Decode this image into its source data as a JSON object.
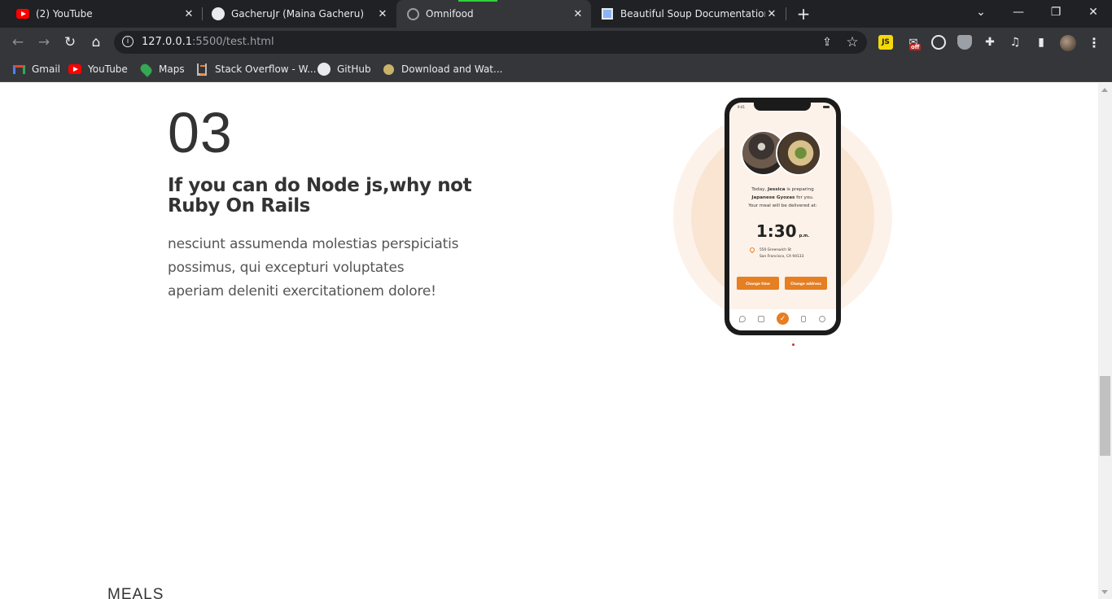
{
  "browser": {
    "tabs": [
      {
        "title": "(2) YouTube",
        "icon": "youtube-icon"
      },
      {
        "title": "GacheruJr (Maina Gacheru)",
        "icon": "github-icon"
      },
      {
        "title": "Omnifood",
        "icon": "globe-icon",
        "active": true
      },
      {
        "title": "Beautiful Soup Documentation —",
        "icon": "doc-icon"
      }
    ],
    "close_glyph": "✕",
    "new_tab_glyph": "+",
    "window": {
      "chevron": "⌄",
      "minimize": "—",
      "restore": "❐",
      "close": "✕"
    },
    "url_host": "127.0.0.1",
    "url_path": ":5500/test.html",
    "toolbar_glyphs": {
      "back": "←",
      "forward": "→",
      "reload": "↻",
      "home": "⌂",
      "info": "i",
      "share": "⇪",
      "star": "☆",
      "menu": "⋮",
      "puzzle": "✚",
      "sidepanel": "▮",
      "media": "♫",
      "mail": "✉",
      "ext_js": "JS",
      "ext_off": "off"
    },
    "bookmarks": [
      {
        "label": "Gmail",
        "icon": "gmail-icon"
      },
      {
        "label": "YouTube",
        "icon": "youtube-icon"
      },
      {
        "label": "Maps",
        "icon": "maps-icon"
      },
      {
        "label": "Stack Overflow - W...",
        "icon": "stackoverflow-icon"
      },
      {
        "label": "GitHub",
        "icon": "github-icon"
      },
      {
        "label": "Download and Wat...",
        "icon": "download-icon"
      }
    ]
  },
  "step": {
    "number": "03",
    "title": "If you can do Node js,why not Ruby On Rails",
    "description": "nesciunt assumenda molestias perspiciatis possimus, qui excepturi voluptates aperiam deleniti exercitationem dolore!"
  },
  "phone": {
    "status_time": "9:41",
    "meal_line1_pre": "Today, ",
    "meal_name": "Jessica",
    "meal_line1_post": " is preparing",
    "meal_dish": "Japanese Gyozas",
    "meal_line2_post": " for you.",
    "meal_line3": "Your meal will be delivered at:",
    "eta_time": "1:30",
    "eta_suffix": "p.m.",
    "address_line1": "550 Greenwich St",
    "address_line2": "San Francisco, CA 94133",
    "button_change_time": "Change time",
    "button_change_address": "Change address",
    "check_glyph": "✓"
  },
  "next_section_label": "MEALS",
  "colors": {
    "accent": "#e67e22",
    "tint_light": "#fdf2e9",
    "tint": "#fae5d3"
  }
}
